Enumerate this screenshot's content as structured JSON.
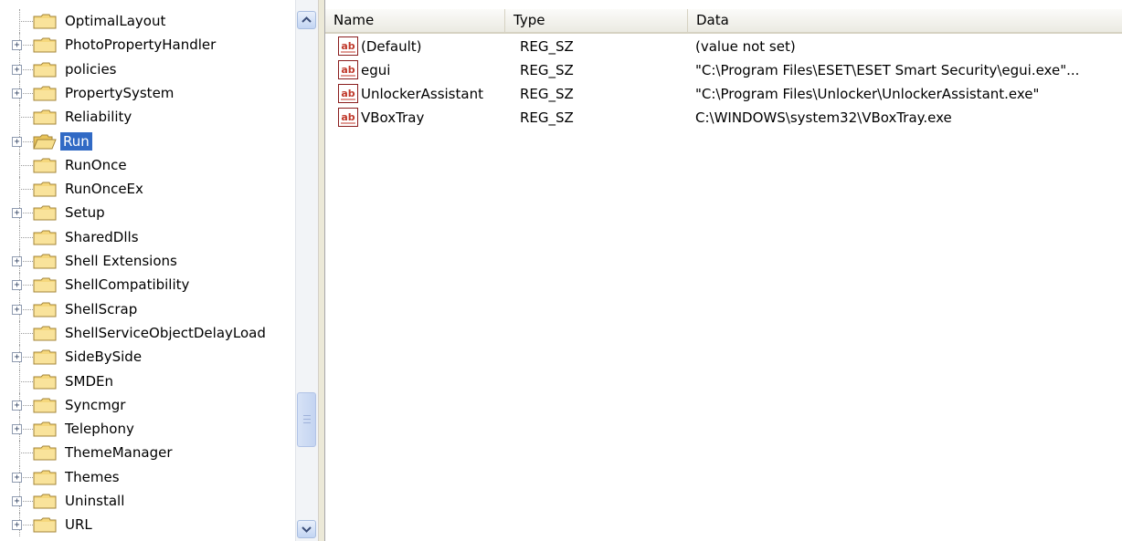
{
  "tree": {
    "items": [
      {
        "label": "OptimalLayout",
        "expandable": false,
        "selected": false
      },
      {
        "label": "PhotoPropertyHandler",
        "expandable": true,
        "selected": false
      },
      {
        "label": "policies",
        "expandable": true,
        "selected": false
      },
      {
        "label": "PropertySystem",
        "expandable": true,
        "selected": false
      },
      {
        "label": "Reliability",
        "expandable": false,
        "selected": false
      },
      {
        "label": "Run",
        "expandable": true,
        "selected": true
      },
      {
        "label": "RunOnce",
        "expandable": false,
        "selected": false
      },
      {
        "label": "RunOnceEx",
        "expandable": false,
        "selected": false
      },
      {
        "label": "Setup",
        "expandable": true,
        "selected": false
      },
      {
        "label": "SharedDlls",
        "expandable": false,
        "selected": false
      },
      {
        "label": "Shell Extensions",
        "expandable": true,
        "selected": false
      },
      {
        "label": "ShellCompatibility",
        "expandable": true,
        "selected": false
      },
      {
        "label": "ShellScrap",
        "expandable": true,
        "selected": false
      },
      {
        "label": "ShellServiceObjectDelayLoad",
        "expandable": false,
        "selected": false
      },
      {
        "label": "SideBySide",
        "expandable": true,
        "selected": false
      },
      {
        "label": "SMDEn",
        "expandable": false,
        "selected": false
      },
      {
        "label": "Syncmgr",
        "expandable": true,
        "selected": false
      },
      {
        "label": "Telephony",
        "expandable": true,
        "selected": false
      },
      {
        "label": "ThemeManager",
        "expandable": false,
        "selected": false
      },
      {
        "label": "Themes",
        "expandable": true,
        "selected": false
      },
      {
        "label": "Uninstall",
        "expandable": true,
        "selected": false
      },
      {
        "label": "URL",
        "expandable": true,
        "selected": false
      }
    ],
    "expander_glyph": "+"
  },
  "list": {
    "columns": {
      "name": "Name",
      "type": "Type",
      "data": "Data"
    },
    "rows": [
      {
        "name": "(Default)",
        "type": "REG_SZ",
        "data": "(value not set)"
      },
      {
        "name": "egui",
        "type": "REG_SZ",
        "data": "\"C:\\Program Files\\ESET\\ESET Smart Security\\egui.exe\"..."
      },
      {
        "name": "UnlockerAssistant",
        "type": "REG_SZ",
        "data": "\"C:\\Program Files\\Unlocker\\UnlockerAssistant.exe\""
      },
      {
        "name": "VBoxTray",
        "type": "REG_SZ",
        "data": "C:\\WINDOWS\\system32\\VBoxTray.exe"
      }
    ],
    "value_icon": "string-value-icon"
  },
  "icons": {
    "folder": "folder-icon",
    "folder_open": "folder-open-icon"
  },
  "colors": {
    "selection": "#316ac5",
    "folder": "#f5d77c",
    "value_icon_red": "#c0392b"
  }
}
